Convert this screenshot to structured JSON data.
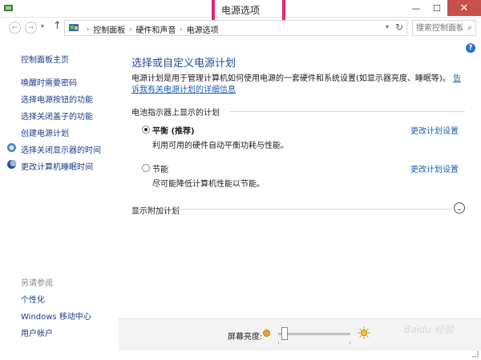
{
  "window": {
    "title": "电源选项",
    "minimize": "—",
    "maximize": "☐",
    "close": "✕"
  },
  "addressbar": {
    "back": "←",
    "forward": "→",
    "history": "▾",
    "up": "↑",
    "breadcrumbs": [
      "控制面板",
      "硬件和声音",
      "电源选项"
    ],
    "separator": "›",
    "refresh": "↻",
    "search_placeholder": "搜索控制面板",
    "search_icon": "⌕"
  },
  "sidebar": {
    "home": "控制面板主页",
    "links": [
      "唤醒时需要密码",
      "选择电源按钮的功能",
      "选择关闭盖子的功能",
      "创建电源计划",
      "选择关闭显示器的时间",
      "更改计算机睡眠时间"
    ],
    "see_also_heading": "另请参阅",
    "see_also": [
      "个性化",
      "Windows 移动中心",
      "用户帐户"
    ]
  },
  "main": {
    "help": "?",
    "title": "选择或自定义电源计划",
    "description": "电源计划是用于管理计算机如何使用电源的一套硬件和系统设置(如显示器亮度、睡眠等)。",
    "description_link": "告诉我有关电源计划的详细信息",
    "group_label": "电池指示器上显示的计划",
    "plans": [
      {
        "name": "平衡 (推荐)",
        "description": "利用可用的硬件自动平衡功耗与性能。",
        "selected": true,
        "change": "更改计划设置"
      },
      {
        "name": "节能",
        "description": "尽可能降低计算机性能以节能。",
        "selected": false,
        "change": "更改计划设置"
      }
    ],
    "additional_plans": "显示附加计划",
    "expand": "⌄"
  },
  "bottombar": {
    "brightness_label": "屏幕亮度:",
    "brightness_level": 0.05,
    "watermark": "Baidu 经验"
  },
  "colors": {
    "highlight_box": "#e5267a",
    "link": "#1a5fb4",
    "title": "#1f4e97",
    "close_button": "#c7504a"
  }
}
